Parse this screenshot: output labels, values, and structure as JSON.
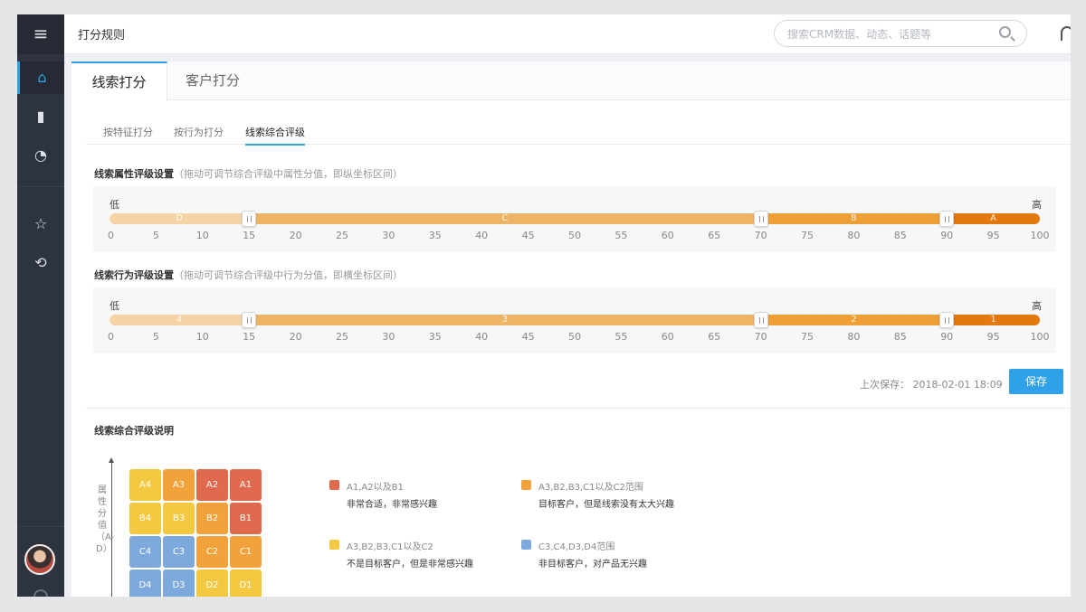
{
  "sidebar": {
    "menu_glyph": "≡",
    "items": [
      {
        "name": "home-icon",
        "glyph": "⌂"
      },
      {
        "name": "bar-chart-icon",
        "glyph": "▮"
      },
      {
        "name": "pie-chart-icon",
        "glyph": "◔"
      },
      {
        "name": "star-icon",
        "glyph": "☆"
      },
      {
        "name": "history-icon",
        "glyph": "⟲"
      }
    ]
  },
  "header": {
    "title": "打分规则",
    "search_placeholder": "搜索CRM数据、动态、话题等"
  },
  "main_tabs": [
    "线索打分",
    "客户打分"
  ],
  "sub_tabs": [
    "按特征打分",
    "按行为打分",
    "线索综合评级"
  ],
  "attr_section": {
    "title": "线索属性评级设置",
    "hint": "（拖动可调节综合评级中属性分值，即纵坐标区间）",
    "low": "低",
    "high": "高",
    "segments": [
      {
        "label": "D",
        "from": 0,
        "to": 15,
        "color": "#f5d3a4"
      },
      {
        "label": "C",
        "from": 15,
        "to": 70,
        "color": "#eeb466"
      },
      {
        "label": "B",
        "from": 70,
        "to": 90,
        "color": "#ee9f35"
      },
      {
        "label": "A",
        "from": 90,
        "to": 100,
        "color": "#e2780e"
      }
    ]
  },
  "behavior_section": {
    "title": "线索行为评级设置",
    "hint": "（拖动可调节综合评级中行为分值，即横坐标区间）",
    "low": "低",
    "high": "高",
    "segments": [
      {
        "label": "4",
        "from": 0,
        "to": 15,
        "color": "#f5d3a4"
      },
      {
        "label": "3",
        "from": 15,
        "to": 70,
        "color": "#eeb466"
      },
      {
        "label": "2",
        "from": 70,
        "to": 90,
        "color": "#ee9f35"
      },
      {
        "label": "1",
        "from": 90,
        "to": 100,
        "color": "#e2780e"
      }
    ]
  },
  "ticks": [
    "0",
    "5",
    "10",
    "15",
    "20",
    "25",
    "30",
    "35",
    "40",
    "45",
    "50",
    "55",
    "60",
    "65",
    "70",
    "75",
    "80",
    "85",
    "90",
    "95",
    "100"
  ],
  "save": {
    "last_saved": "上次保存：  2018-02-01  18:09",
    "button": "保存"
  },
  "explain": {
    "title": "线索综合评级说明",
    "axis_label": "属性分值（A-D）",
    "matrix": [
      [
        "A4",
        "A3",
        "A2",
        "A1"
      ],
      [
        "B4",
        "B3",
        "B2",
        "B1"
      ],
      [
        "C4",
        "C3",
        "C2",
        "C1"
      ],
      [
        "D4",
        "D3",
        "D2",
        "D1"
      ]
    ],
    "matrix_colors": [
      [
        "#f5c842",
        "#f2a23a",
        "#e06a4e",
        "#e06a4e"
      ],
      [
        "#f5c842",
        "#f5c842",
        "#f2a23a",
        "#e06a4e"
      ],
      [
        "#7ea9dc",
        "#7ea9dc",
        "#f2a23a",
        "#f2a23a"
      ],
      [
        "#7ea9dc",
        "#7ea9dc",
        "#f5c842",
        "#f5c842"
      ]
    ],
    "legend": [
      {
        "color": "#e06a4e",
        "range": "A1,A2以及B1",
        "desc": "非常合适，非常感兴趣"
      },
      {
        "color": "#f2a23a",
        "range": "A3,B2,B3,C1以及C2范围",
        "desc": "目标客户，但是线索没有太大兴趣"
      },
      {
        "color": "#f5c842",
        "range": "A3,B2,B3,C1以及C2",
        "desc": "不是目标客户，但是非常感兴趣"
      },
      {
        "color": "#7ea9dc",
        "range": "C3,C4,D3,D4范围",
        "desc": "非目标客户，对产品无兴趣"
      }
    ]
  }
}
